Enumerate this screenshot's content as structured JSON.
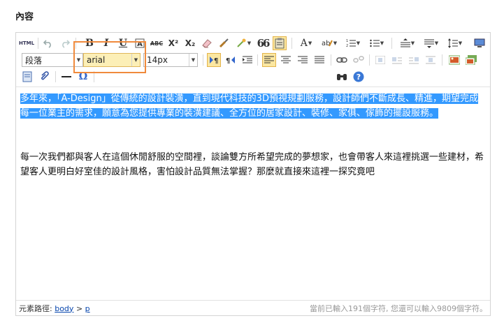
{
  "section": {
    "title": "內容"
  },
  "toolbar": {
    "html_label": "HTML",
    "bold_label": "B",
    "italic_label": "I",
    "underline_label": "U",
    "strike_label": "ABC",
    "sup_label": "X²",
    "sub_label": "X₂",
    "quote_label": "66",
    "font_color_label": "A",
    "omega_label": "Ω",
    "help_label": "?",
    "paragraph_value": "段落",
    "font_value": "arial",
    "size_value": "14px"
  },
  "content": {
    "p1": "多年來，「A-Design」從傳統的設計裝潢，直到現代科技的3D預視規劃服務，設計師們不斷成長、精進，期望完成每一位業主的需求，願意為您提供專業的裝潢建議、全方位的居家設計、裝修、家俱、傢飾的擺設服務。",
    "p2": "每一次我們都與客人在這個休閒舒服的空間裡，談論雙方所希望完成的夢想家，也會帶客人來這裡挑選一些建材，希望客人更明白好室佳的設計風格，害怕設計品質無法掌握？那麼就直接來這裡一探究竟吧"
  },
  "status": {
    "path_label": "元素路徑:",
    "path_body": "body",
    "path_sep": ">",
    "path_p": "p",
    "count_text": "當前已輸入191個字符, 您還可以輸入9809個字符。"
  },
  "colors": {
    "selection": "#3399ff",
    "highlight_frame": "#f08a3c",
    "active_button": "#fbe7a1"
  }
}
